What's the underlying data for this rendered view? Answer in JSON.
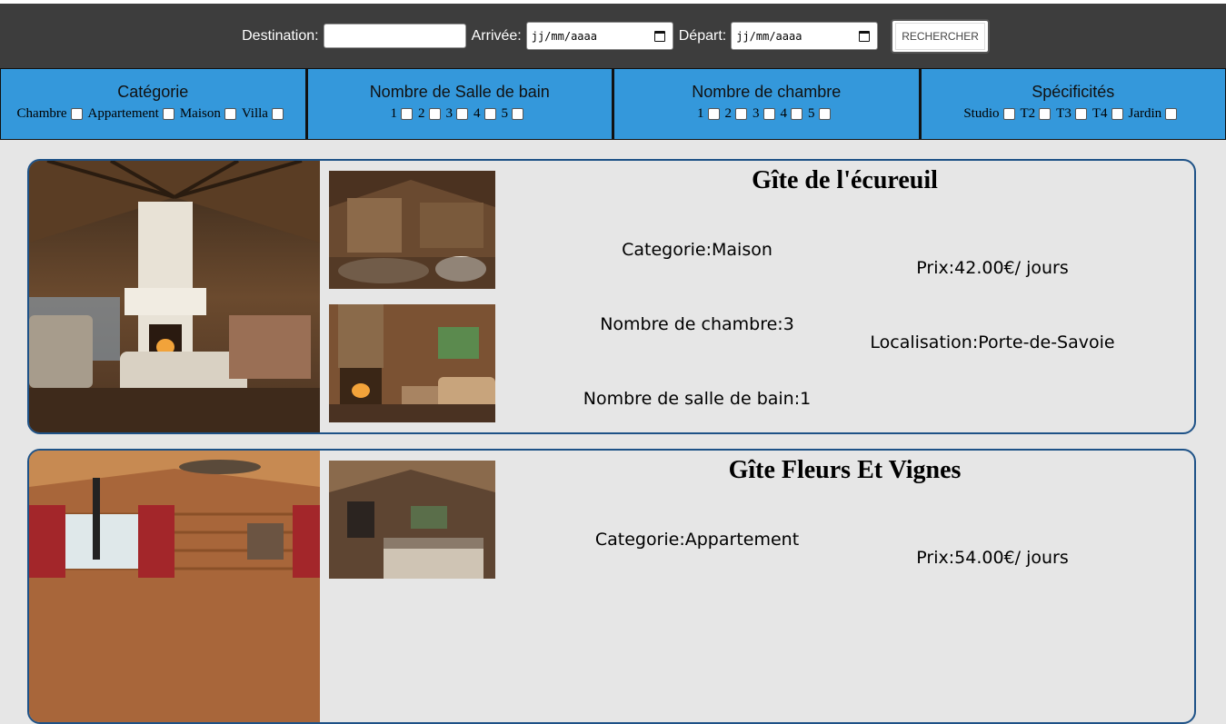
{
  "search": {
    "destination_label": "Destination:",
    "destination_value": "",
    "arrival_label": "Arrivée:",
    "arrival_placeholder": "jj/mm/aaaa",
    "departure_label": "Départ:",
    "departure_placeholder": "jj/mm/aaaa",
    "button_label": "RECHERCHER"
  },
  "filters": [
    {
      "title": "Catégorie",
      "options": [
        "Chambre",
        "Appartement",
        "Maison",
        "Villa"
      ]
    },
    {
      "title": "Nombre de Salle de bain",
      "options": [
        "1",
        "2",
        "3",
        "4",
        "5"
      ]
    },
    {
      "title": "Nombre de chambre",
      "options": [
        "1",
        "2",
        "3",
        "4",
        "5"
      ]
    },
    {
      "title": "Spécificités",
      "options": [
        "Studio",
        "T2",
        "T3",
        "T4",
        "Jardin"
      ]
    }
  ],
  "listings": [
    {
      "title": "Gîte de l'écureuil",
      "categorie": "Categorie:Maison",
      "chambres": "Nombre de chambre:3",
      "salles_de_bain": "Nombre de salle de bain:1",
      "prix": "Prix:42.00€/ jours",
      "localisation": "Localisation:Porte-de-Savoie"
    },
    {
      "title": "Gîte Fleurs Et Vignes",
      "categorie": "Categorie:Appartement",
      "prix": "Prix:54.00€/ jours"
    }
  ],
  "colors": {
    "header_bg": "#3d3d3d",
    "filter_bg": "#3498db",
    "card_border": "#1e5287",
    "page_bg": "#e6e6e6"
  }
}
